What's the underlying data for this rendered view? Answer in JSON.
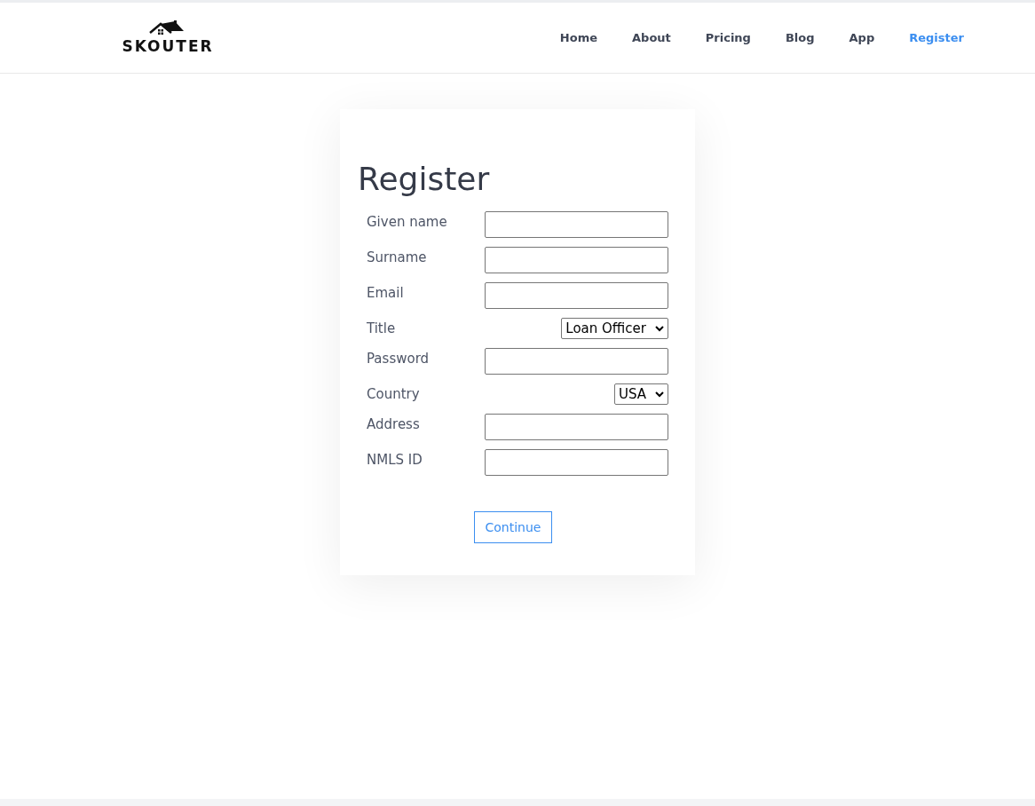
{
  "header": {
    "logo": {
      "text": "SKOUTER"
    },
    "nav": [
      {
        "label": "Home",
        "selected": false
      },
      {
        "label": "About",
        "selected": false
      },
      {
        "label": "Pricing",
        "selected": false
      },
      {
        "label": "Blog",
        "selected": false
      },
      {
        "label": "App",
        "selected": false
      },
      {
        "label": "Register",
        "selected": true
      }
    ]
  },
  "form": {
    "title": "Register",
    "fields": [
      {
        "label": "Given name",
        "kind": "text"
      },
      {
        "label": "Surname",
        "kind": "text"
      },
      {
        "label": "Email",
        "kind": "text"
      },
      {
        "label": "Title",
        "kind": "select",
        "value": "Loan Officer"
      },
      {
        "label": "Password",
        "kind": "text"
      },
      {
        "label": "Country",
        "kind": "select",
        "value": "USA"
      },
      {
        "label": "Address",
        "kind": "text"
      },
      {
        "label": "NMLS ID",
        "kind": "text"
      }
    ],
    "button": "Continue"
  }
}
